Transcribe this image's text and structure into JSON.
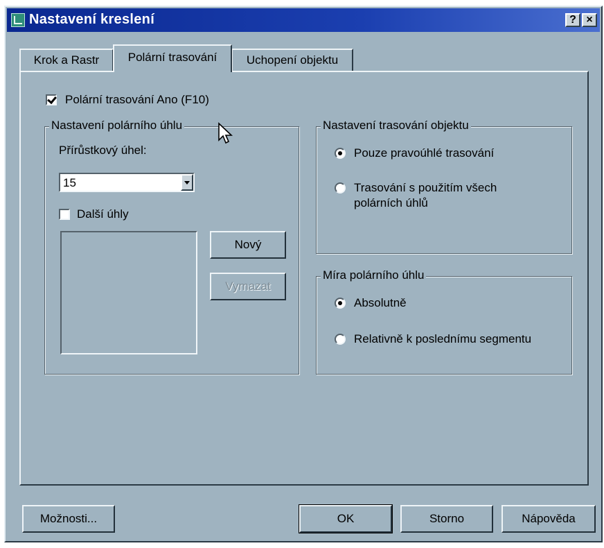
{
  "window": {
    "title": "Nastavení kreslení",
    "help_label": "?",
    "close_label": "×"
  },
  "tabs": [
    {
      "label": "Krok a Rastr",
      "active": false
    },
    {
      "label": "Polární trasování",
      "active": true
    },
    {
      "label": "Uchopení objektu",
      "active": false
    }
  ],
  "polar_tracking": {
    "enable_label": "Polární trasování Ano (F10)",
    "enabled": true
  },
  "polar_angle_settings": {
    "legend": "Nastavení polárního úhlu",
    "increment_label": "Přírůstkový úhel:",
    "increment_value": "15",
    "additional_label": "Další úhly",
    "additional_checked": false,
    "new_button": "Nový",
    "delete_button": "Vymazat"
  },
  "object_tracking": {
    "legend": "Nastavení trasování objektu",
    "option1": "Pouze pravoúhlé trasování",
    "option2_line1": "Trasování s použitím všech",
    "option2_line2": "polárních úhlů",
    "selected": 1
  },
  "polar_measure": {
    "legend": "Míra polárního úhlu",
    "option1": "Absolutně",
    "option2": "Relativně k poslednímu segmentu",
    "selected": 1
  },
  "footer": {
    "options_button": "Možnosti...",
    "ok_button": "OK",
    "cancel_button": "Storno",
    "help_button": "Nápověda"
  },
  "colors": {
    "dialog_bg": "#9fb3c0",
    "titlebar": "#0a2fa0"
  }
}
